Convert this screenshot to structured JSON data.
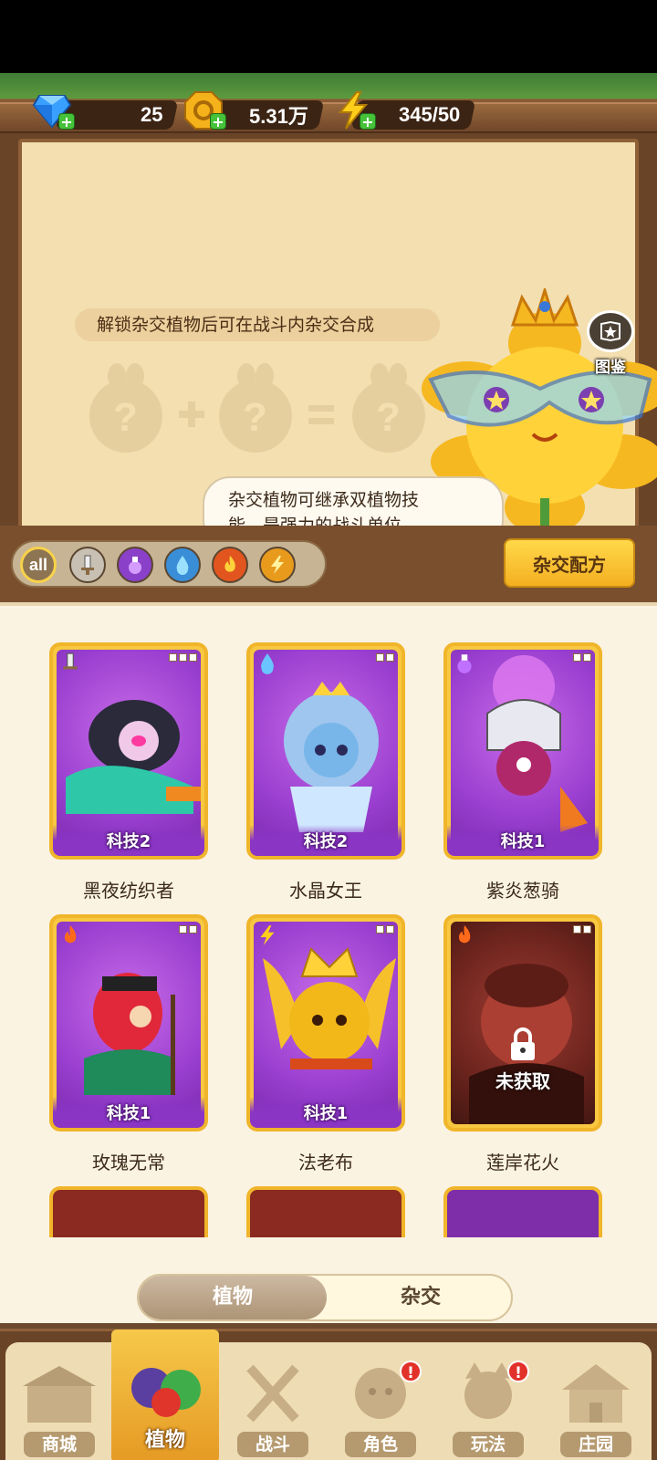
{
  "resources": {
    "diamonds": "25",
    "coins": "5.31万",
    "energy": "345/50"
  },
  "board": {
    "unlock_tip": "解锁杂交植物后可在战斗内杂交合成",
    "speech_line1": "杂交植物可继承双植物技",
    "speech_line2": "能，是强力的战斗单位",
    "guide_label": "图鉴"
  },
  "filters": {
    "all_label": "all",
    "items": [
      "sword-element-icon",
      "potion-element-icon",
      "water-element-icon",
      "fire-element-icon",
      "lightning-element-icon"
    ]
  },
  "recipe_button": "杂交配方",
  "cards": [
    {
      "name": "黑夜纺织者",
      "tag": "科技2",
      "element": "sword",
      "locked": false
    },
    {
      "name": "水晶女王",
      "tag": "科技2",
      "element": "water",
      "locked": false
    },
    {
      "name": "紫炎葱骑",
      "tag": "科技1",
      "element": "potion",
      "locked": false
    },
    {
      "name": "玫瑰无常",
      "tag": "科技1",
      "element": "fire",
      "locked": false
    },
    {
      "name": "法老布",
      "tag": "科技1",
      "element": "lightning",
      "locked": false
    },
    {
      "name": "莲岸花火",
      "tag": "未获取",
      "element": "fire",
      "locked": true
    }
  ],
  "segment": {
    "plants": "植物",
    "hybrid": "杂交",
    "active": "plants"
  },
  "nav": [
    {
      "label": "商城",
      "badge": ""
    },
    {
      "label": "植物",
      "badge": ""
    },
    {
      "label": "战斗",
      "badge": ""
    },
    {
      "label": "角色",
      "badge": "!"
    },
    {
      "label": "玩法",
      "badge": "!"
    },
    {
      "label": "庄园",
      "badge": ""
    }
  ],
  "colors": {
    "card_border": "#f0b52a",
    "card_purple": "#9a3fd0",
    "accent_yellow": "#ffd84a",
    "badge_red": "#e2312a"
  }
}
